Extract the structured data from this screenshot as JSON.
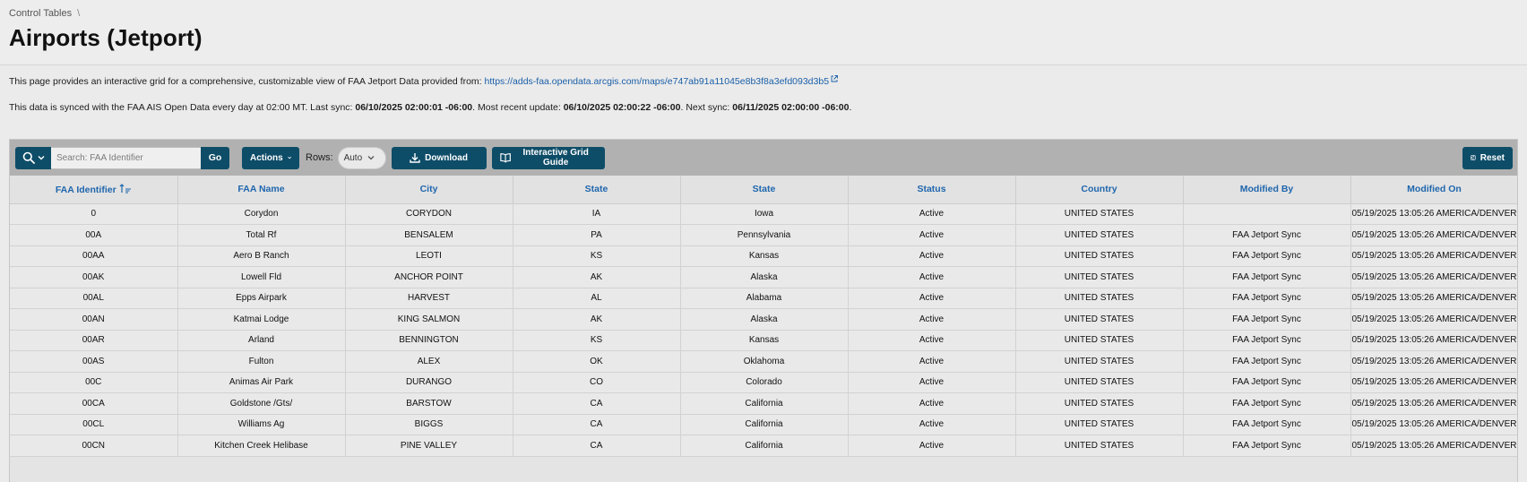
{
  "breadcrumb": {
    "parent": "Control Tables",
    "separator": "\\"
  },
  "page_title": "Airports (Jetport)",
  "description": {
    "line1_prefix": "This page provides an interactive grid for a comprehensive, customizable view of FAA Jetport Data provided from: ",
    "link": "https://adds-faa.opendata.arcgis.com/maps/e747ab91a11045e8b3f8a3efd093d3b5",
    "line2_a": "This data is synced with the FAA AIS Open Data every day at 02:00 MT. Last sync: ",
    "last_sync": "06/10/2025 02:00:01 -06:00",
    "line2_b": ". Most recent update: ",
    "recent_update": "06/10/2025 02:00:22 -06:00",
    "line2_c": ". Next sync: ",
    "next_sync": "06/11/2025 02:00:00 -06:00",
    "line2_d": "."
  },
  "toolbar": {
    "search_placeholder": "Search: FAA Identifier",
    "go_label": "Go",
    "actions_label": "Actions",
    "rows_label": "Rows:",
    "rows_value": "Auto",
    "download_label": "Download",
    "guide_label": "Interactive Grid Guide",
    "reset_label": "Reset"
  },
  "table": {
    "columns": [
      "FAA Identifier",
      "FAA Name",
      "City",
      "State",
      "State",
      "Status",
      "Country",
      "Modified By",
      "Modified On"
    ],
    "rows": [
      [
        "0",
        "Corydon",
        "CORYDON",
        "IA",
        "Iowa",
        "Active",
        "UNITED STATES",
        "",
        "05/19/2025 13:05:26 AMERICA/DENVER"
      ],
      [
        "00A",
        "Total Rf",
        "BENSALEM",
        "PA",
        "Pennsylvania",
        "Active",
        "UNITED STATES",
        "FAA Jetport Sync",
        "05/19/2025 13:05:26 AMERICA/DENVER"
      ],
      [
        "00AA",
        "Aero B Ranch",
        "LEOTI",
        "KS",
        "Kansas",
        "Active",
        "UNITED STATES",
        "FAA Jetport Sync",
        "05/19/2025 13:05:26 AMERICA/DENVER"
      ],
      [
        "00AK",
        "Lowell Fld",
        "ANCHOR POINT",
        "AK",
        "Alaska",
        "Active",
        "UNITED STATES",
        "FAA Jetport Sync",
        "05/19/2025 13:05:26 AMERICA/DENVER"
      ],
      [
        "00AL",
        "Epps Airpark",
        "HARVEST",
        "AL",
        "Alabama",
        "Active",
        "UNITED STATES",
        "FAA Jetport Sync",
        "05/19/2025 13:05:26 AMERICA/DENVER"
      ],
      [
        "00AN",
        "Katmai Lodge",
        "KING SALMON",
        "AK",
        "Alaska",
        "Active",
        "UNITED STATES",
        "FAA Jetport Sync",
        "05/19/2025 13:05:26 AMERICA/DENVER"
      ],
      [
        "00AR",
        "Arland",
        "BENNINGTON",
        "KS",
        "Kansas",
        "Active",
        "UNITED STATES",
        "FAA Jetport Sync",
        "05/19/2025 13:05:26 AMERICA/DENVER"
      ],
      [
        "00AS",
        "Fulton",
        "ALEX",
        "OK",
        "Oklahoma",
        "Active",
        "UNITED STATES",
        "FAA Jetport Sync",
        "05/19/2025 13:05:26 AMERICA/DENVER"
      ],
      [
        "00C",
        "Animas Air Park",
        "DURANGO",
        "CO",
        "Colorado",
        "Active",
        "UNITED STATES",
        "FAA Jetport Sync",
        "05/19/2025 13:05:26 AMERICA/DENVER"
      ],
      [
        "00CA",
        "Goldstone /Gts/",
        "BARSTOW",
        "CA",
        "California",
        "Active",
        "UNITED STATES",
        "FAA Jetport Sync",
        "05/19/2025 13:05:26 AMERICA/DENVER"
      ],
      [
        "00CL",
        "Williams Ag",
        "BIGGS",
        "CA",
        "California",
        "Active",
        "UNITED STATES",
        "FAA Jetport Sync",
        "05/19/2025 13:05:26 AMERICA/DENVER"
      ],
      [
        "00CN",
        "Kitchen Creek Helibase",
        "PINE VALLEY",
        "CA",
        "California",
        "Active",
        "UNITED STATES",
        "FAA Jetport Sync",
        "05/19/2025 13:05:26 AMERICA/DENVER"
      ]
    ]
  },
  "colors": {
    "primary_button": "#0e4d68",
    "header_text": "#1f66ad",
    "link": "#1a5fa8"
  }
}
